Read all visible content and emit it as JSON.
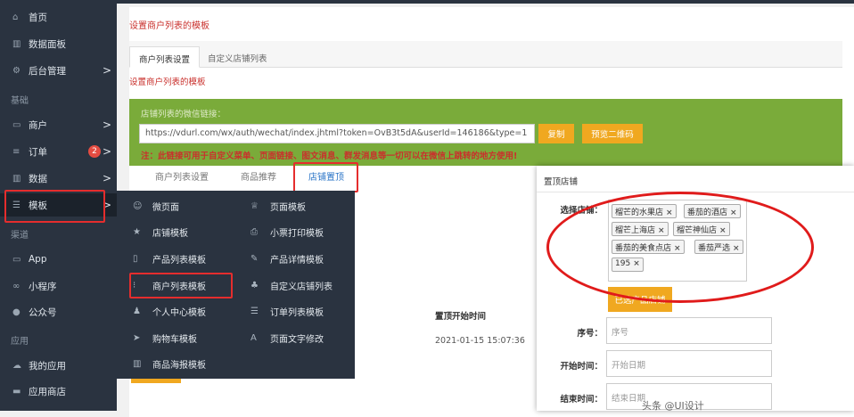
{
  "sidebar": {
    "items": [
      {
        "icon": "home-icon",
        "glyph": "⌂",
        "label": "首页"
      },
      {
        "icon": "dashboard-icon",
        "glyph": "▥",
        "label": "数据面板"
      },
      {
        "icon": "settings-icon",
        "glyph": "⚙",
        "label": "后台管理",
        "chevron": ">"
      },
      {
        "icon": "shop-icon",
        "glyph": "▭",
        "label": "商户",
        "chevron": ">"
      },
      {
        "icon": "order-icon",
        "glyph": "≡",
        "label": "订单",
        "chevron": ">",
        "badge": "2"
      },
      {
        "icon": "chart-icon",
        "glyph": "▥",
        "label": "数据",
        "chevron": ">"
      },
      {
        "icon": "template-icon",
        "glyph": "☰",
        "label": "模板",
        "chevron": ">"
      },
      {
        "icon": "app-icon",
        "glyph": "▭",
        "label": "App"
      },
      {
        "icon": "miniprogram-icon",
        "glyph": "∞",
        "label": "小程序"
      },
      {
        "icon": "wechat-icon",
        "glyph": "●",
        "label": "公众号"
      },
      {
        "icon": "cloud-icon",
        "glyph": "☁",
        "label": "我的应用"
      },
      {
        "icon": "store-icon",
        "glyph": "▬",
        "label": "应用商店"
      }
    ],
    "groups": [
      "基础",
      "渠道",
      "应用"
    ]
  },
  "page": {
    "title": "设置商户列表的模板",
    "tabs": [
      "商户列表设置",
      "自定义店铺列表"
    ],
    "subtitle": "设置商户列表的模板",
    "link_label": "店铺列表的微信链接：",
    "url": "https://vdurl.com/wx/auth/wechat/index.jhtml?token=OvB3t5dA&userId=146186&type=1",
    "copy_btn": "复制",
    "qr_btn": "预览二维码",
    "note": "注：此链接可用于自定义菜单、页面链接、图文消息、群发消息等一切可以在微信上跳转的地方使用!",
    "inner_tabs": [
      "商户列表设置",
      "商品推荐",
      "店铺置顶"
    ]
  },
  "dropdown": {
    "left": [
      {
        "icon": "smiley-icon",
        "glyph": "☺",
        "label": "微页面"
      },
      {
        "icon": "star-icon",
        "glyph": "★",
        "label": "店铺模板"
      },
      {
        "icon": "mobile-icon",
        "glyph": "▯",
        "label": "产品列表模板"
      },
      {
        "icon": "file-icon",
        "glyph": "⁝",
        "label": "商户列表模板"
      },
      {
        "icon": "user-icon",
        "glyph": "♟",
        "label": "个人中心模板"
      },
      {
        "icon": "cart-icon",
        "glyph": "➤",
        "label": "购物车模板"
      },
      {
        "icon": "poster-icon",
        "glyph": "▥",
        "label": "商品海报模板"
      }
    ],
    "right": [
      {
        "icon": "trophy-icon",
        "glyph": "♕",
        "label": "页面模板"
      },
      {
        "icon": "printer-icon",
        "glyph": "⎙",
        "label": "小票打印模板"
      },
      {
        "icon": "pencil-icon",
        "glyph": "✎",
        "label": "产品详情模板"
      },
      {
        "icon": "sitemap-icon",
        "glyph": "♣",
        "label": "自定义店铺列表"
      },
      {
        "icon": "list-icon",
        "glyph": "☰",
        "label": "订单列表模板"
      },
      {
        "icon": "font-icon",
        "glyph": "A",
        "label": "页面文字修改"
      }
    ]
  },
  "table": {
    "header": "置顶开始时间",
    "cell": "2021-01-15 15:07:36"
  },
  "modal": {
    "title": "置顶店铺",
    "select_label": "选择店铺：",
    "chips": [
      "榴芒的水果店",
      "番茄的酒店",
      "榴芒上海店",
      "榴芒神仙店",
      "番茄的美食点店",
      "番茄严选",
      "195"
    ],
    "chip_remove": "×",
    "selected_btn": "已选产品店铺",
    "seq_label": "序号：",
    "seq_placeholder": "序号",
    "start_label": "开始时间：",
    "start_placeholder": "开始日期",
    "end_label": "结束时间：",
    "end_placeholder": "结束日期"
  },
  "watermark": "头条 @UI设计"
}
